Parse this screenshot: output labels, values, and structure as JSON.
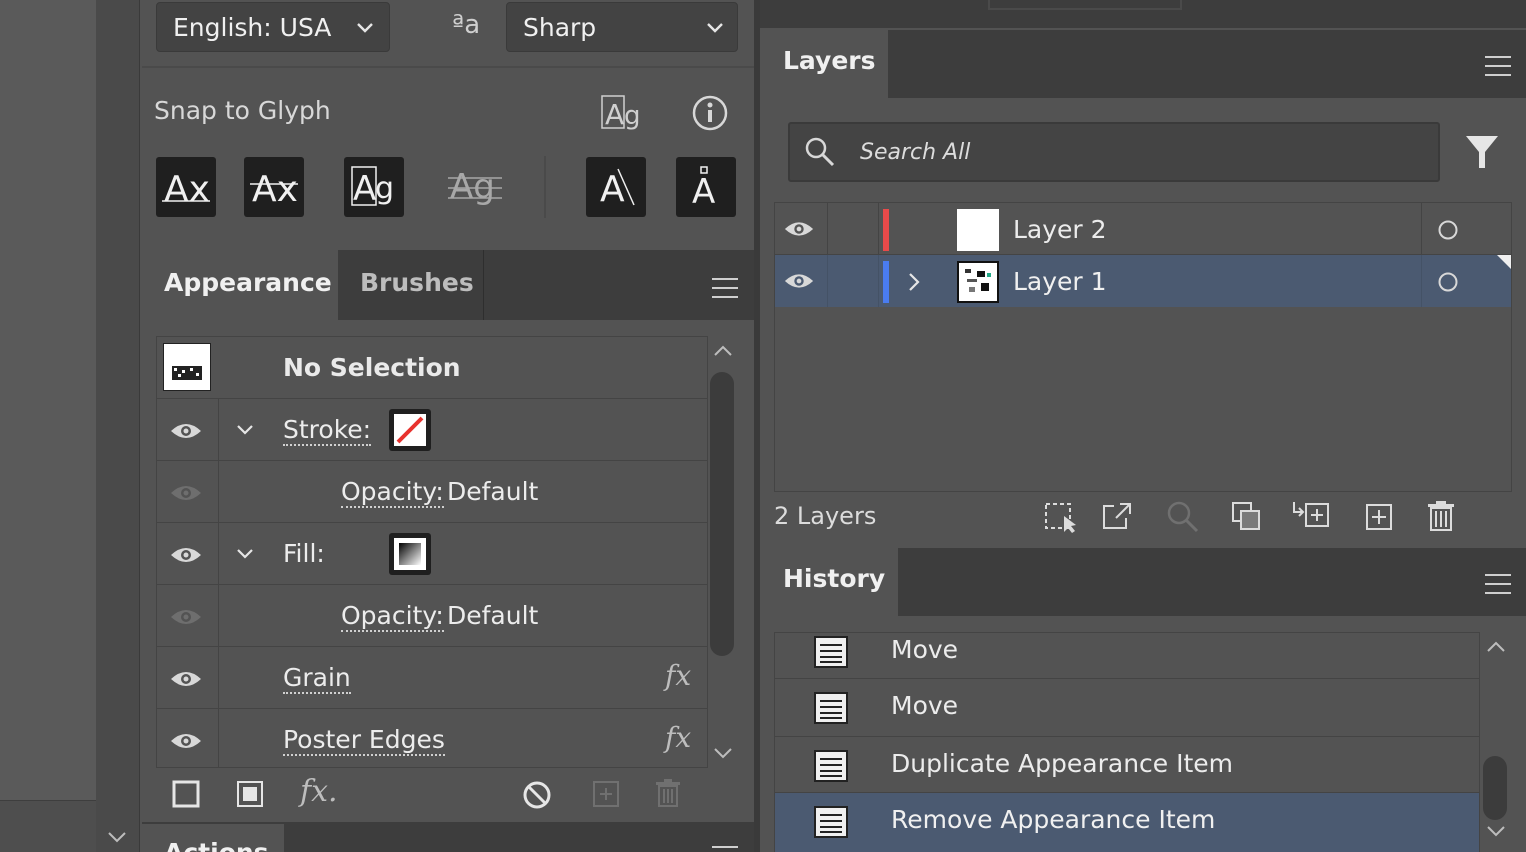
{
  "character": {
    "language": "English: USA",
    "antialias_glyph": "ªa",
    "antialias": "Sharp",
    "snap_label": "Snap to Glyph"
  },
  "appearance_panel": {
    "tabs": [
      "Appearance",
      "Brushes"
    ],
    "selection_label": "No Selection",
    "rows": [
      {
        "label": "Stroke:"
      },
      {
        "label": "Opacity:",
        "value": "Default"
      },
      {
        "label": "Fill:"
      },
      {
        "label": "Opacity:",
        "value": "Default"
      },
      {
        "label": "Grain"
      },
      {
        "label": "Poster Edges"
      }
    ],
    "fx_symbol": "fx",
    "fx_menu_symbol": "fx."
  },
  "actions_tab": "Actions",
  "layers_panel": {
    "tab": "Layers",
    "search_placeholder": "Search All",
    "layers": [
      {
        "name": "Layer 2",
        "color": "#e84a4a"
      },
      {
        "name": "Layer 1",
        "color": "#4a7cf0"
      }
    ],
    "count_label": "2 Layers"
  },
  "history_panel": {
    "tab": "History",
    "items": [
      "Move",
      "Move",
      "Duplicate Appearance Item",
      "Remove Appearance Item"
    ]
  },
  "colors": {
    "selected_row": "#4b5a71",
    "panel": "#535353"
  }
}
